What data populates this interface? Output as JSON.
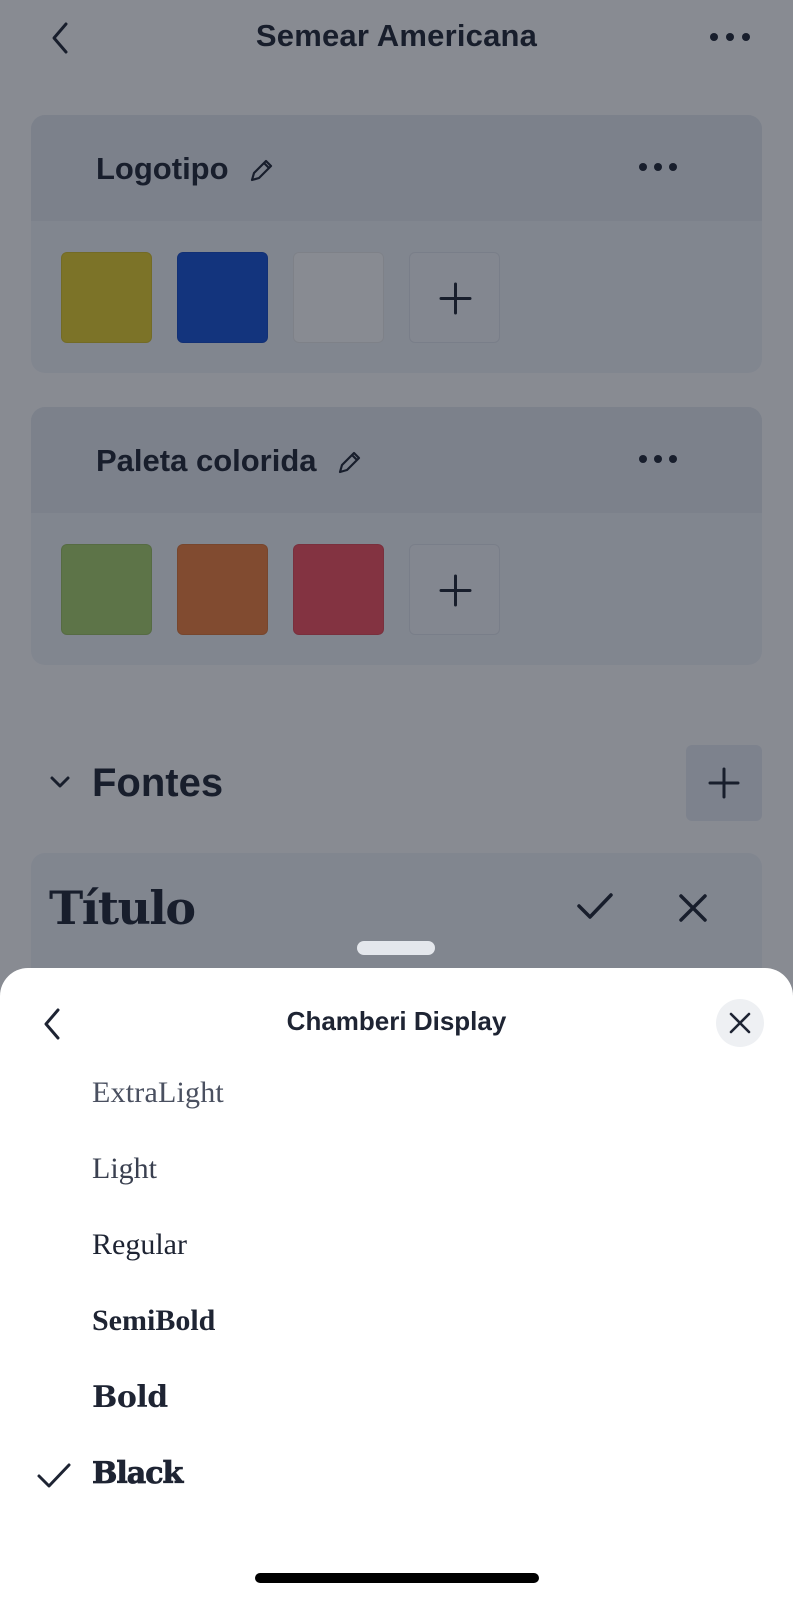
{
  "header": {
    "title": "Semear Americana"
  },
  "palettes": [
    {
      "name": "Logotipo",
      "colors": [
        "#e7cf2a",
        "#1550d5",
        "#ffffff"
      ]
    },
    {
      "name": "Paleta colorida",
      "colors": [
        "#a8d06a",
        "#f07f3a",
        "#f54f5c"
      ]
    }
  ],
  "fonts": {
    "section_label": "Fontes",
    "item_label": "Título"
  },
  "sheet": {
    "title": "Chamberi Display",
    "options": [
      {
        "label": "ExtraLight",
        "selected": false
      },
      {
        "label": "Light",
        "selected": false
      },
      {
        "label": "Regular",
        "selected": false
      },
      {
        "label": "SemiBold",
        "selected": false
      },
      {
        "label": "Bold",
        "selected": false
      },
      {
        "label": "Black",
        "selected": true
      }
    ]
  },
  "icons": {
    "back": "chevron-left-icon",
    "more": "more-horizontal-icon",
    "edit": "pencil-icon",
    "add": "plus-icon",
    "collapse": "chevron-down-icon",
    "confirm": "check-icon",
    "close": "close-icon"
  },
  "colors": {
    "overlay": "#121826",
    "text": "#1e2433",
    "sheet_bg": "#ffffff"
  }
}
